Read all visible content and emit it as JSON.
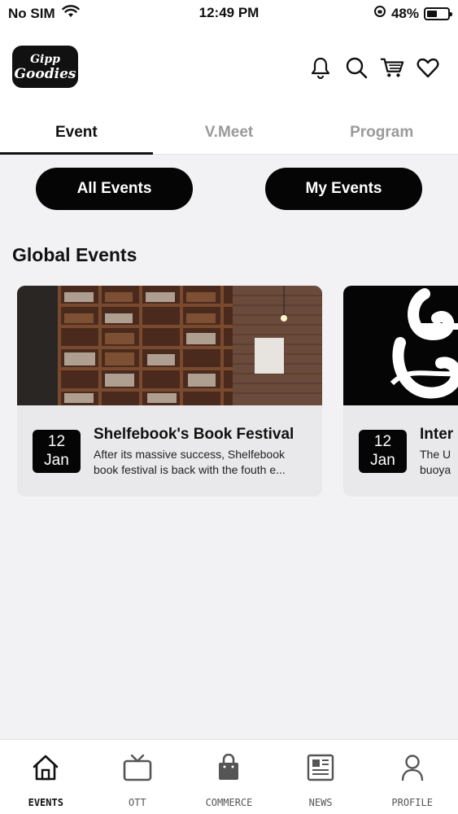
{
  "status_bar": {
    "carrier": "No SIM",
    "time": "12:49 PM",
    "battery": "48%",
    "battery_level": 0.48
  },
  "header": {
    "logo_line1": "Gipp",
    "logo_line2": "Goodies",
    "icons": [
      "bell-icon",
      "search-icon",
      "cart-icon",
      "heart-icon"
    ]
  },
  "tabs": [
    {
      "label": "Event",
      "active": true
    },
    {
      "label": "V.Meet",
      "active": false
    },
    {
      "label": "Program",
      "active": false
    }
  ],
  "filters": {
    "all_events": "All Events",
    "my_events": "My Events"
  },
  "section": {
    "title": "Global Events"
  },
  "events": [
    {
      "day": "12",
      "month": "Jan",
      "title": "Shelfebook's Book Festival",
      "desc_line1": "After its massive success, Shelfebook",
      "desc_line2": "book festival is back with the fouth e..."
    },
    {
      "day": "12",
      "month": "Jan",
      "title": "Inter",
      "desc_line1": "The U",
      "desc_line2": "buoya"
    }
  ],
  "bottom_nav": [
    {
      "label": "EVENTS",
      "icon": "home-icon",
      "active": true
    },
    {
      "label": "OTT",
      "icon": "tv-icon",
      "active": false
    },
    {
      "label": "COMMERCE",
      "icon": "shopping-bag-icon",
      "active": false
    },
    {
      "label": "NEWS",
      "icon": "newspaper-icon",
      "active": false
    },
    {
      "label": "PROFILE",
      "icon": "user-icon",
      "active": false
    }
  ],
  "colors": {
    "accent": "#050505",
    "background": "#f2f2f4",
    "inactive_tab": "#9a9a9a"
  }
}
